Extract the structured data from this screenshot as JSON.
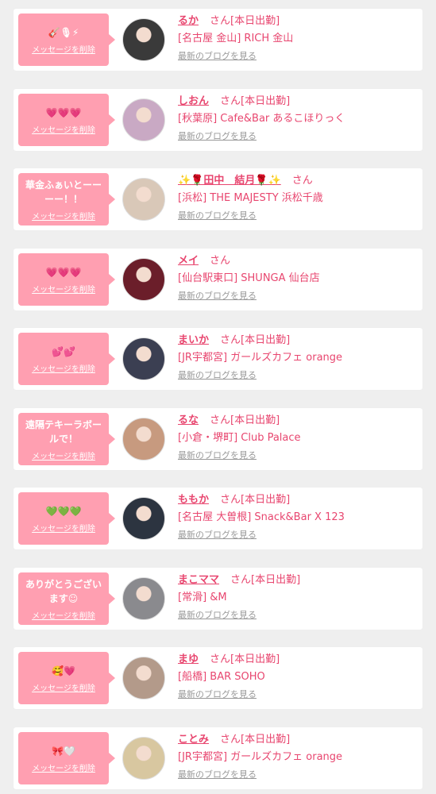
{
  "delete_label": "メッセージを削除",
  "blog_label": "最新のブログを見る",
  "san_suffix": "さん",
  "colors": {
    "background": "#efefef",
    "bubble": "#ff9fb1",
    "accent": "#e8466f",
    "muted": "#999999"
  },
  "cards": [
    {
      "message": "🎸🎙⚡",
      "name": "るか",
      "status": "[本日出勤]",
      "shop": "[名古屋 金山] RICH 金山",
      "avatar_color": "#3a3a3a"
    },
    {
      "message": "💗💗💗",
      "name": "しおん",
      "status": "[本日出勤]",
      "shop": "[秋葉原] Cafe&Bar あるこほりっく",
      "avatar_color": "#c9a9c4"
    },
    {
      "message": "華金ふぁいとーーーー！！",
      "name": "✨🌹田中　結月🌹✨",
      "status": "",
      "shop": "[浜松] THE MAJESTY 浜松千歳",
      "avatar_color": "#d9c8b8"
    },
    {
      "message": "💗💗💗",
      "name": "メイ",
      "status": "",
      "shop": "[仙台駅東口] SHUNGA 仙台店",
      "avatar_color": "#6b1e2a"
    },
    {
      "message": "💕💕",
      "name": "まいか",
      "status": "[本日出勤]",
      "shop": "[JR宇都宮] ガールズカフェ orange",
      "avatar_color": "#3b3f52"
    },
    {
      "message": "遠隔テキーラボールで！",
      "name": "るな",
      "status": "[本日出勤]",
      "shop": "[小倉・堺町] Club Palace",
      "avatar_color": "#c79a7f"
    },
    {
      "message": "💚💚💚",
      "name": "ももか",
      "status": "[本日出勤]",
      "shop": "[名古屋 大曽根] Snack&Bar X 123",
      "avatar_color": "#2c3440"
    },
    {
      "message": "ありがとうございます☺",
      "name": "まこママ",
      "status": "[本日出勤]",
      "shop": "[常滑] &M",
      "avatar_color": "#8a8a8e"
    },
    {
      "message": "🥰💗",
      "name": "まゆ",
      "status": "[本日出勤]",
      "shop": "[船橋] BAR SOHO",
      "avatar_color": "#b39a8a"
    },
    {
      "message": "🎀🤍",
      "name": "ことみ",
      "status": "[本日出勤]",
      "shop": "[JR宇都宮] ガールズカフェ orange",
      "avatar_color": "#d8c7a0"
    }
  ]
}
